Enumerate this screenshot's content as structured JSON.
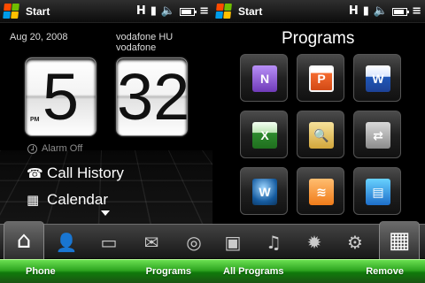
{
  "status_bar": {
    "start_label": "Start",
    "icons": [
      "h-connection-icon",
      "signal-icon",
      "volume-icon",
      "battery-icon",
      "menu-icon"
    ]
  },
  "home": {
    "date": "Aug 20, 2008",
    "carrier": "vodafone HU vodafone",
    "clock": {
      "hour": "5",
      "minute": "32",
      "ampm": "PM"
    },
    "alarm_label": "Alarm Off",
    "links": [
      {
        "label": "Call History",
        "icon": "phone-icon"
      },
      {
        "label": "Calendar",
        "icon": "calendar-icon"
      }
    ]
  },
  "programs": {
    "title": "Programs",
    "tiles": [
      {
        "name": "OneNote",
        "icon": "onenote-icon",
        "glyph": "N"
      },
      {
        "name": "PowerPoint",
        "icon": "powerpoint-icon",
        "glyph": "P"
      },
      {
        "name": "Word",
        "icon": "word-icon",
        "glyph": "W"
      },
      {
        "name": "Excel",
        "icon": "excel-icon",
        "glyph": "X"
      },
      {
        "name": "File Explorer",
        "icon": "folder-search-icon",
        "glyph": "🔍"
      },
      {
        "name": "ActiveSync",
        "icon": "device-sync-icon",
        "glyph": "⇄"
      },
      {
        "name": "WordWeb",
        "icon": "wordweb-icon",
        "glyph": "W"
      },
      {
        "name": "RSS Reader",
        "icon": "rss-icon",
        "glyph": "≋"
      },
      {
        "name": "FM Radio",
        "icon": "radio-icon",
        "glyph": "▤"
      }
    ]
  },
  "dock": {
    "items": [
      {
        "icon": "home-icon",
        "glyph": "⌂",
        "selected": true
      },
      {
        "icon": "person-icon",
        "glyph": "👤",
        "selected": false
      },
      {
        "icon": "message-icon",
        "glyph": "▭",
        "selected": false
      },
      {
        "icon": "mail-icon",
        "glyph": "✉",
        "selected": false
      },
      {
        "icon": "globe-icon",
        "glyph": "◎",
        "selected": false
      },
      {
        "icon": "camera-icon",
        "glyph": "▣",
        "selected": false
      },
      {
        "icon": "music-icon",
        "glyph": "♫",
        "selected": false
      },
      {
        "icon": "weather-icon",
        "glyph": "✹",
        "selected": false
      },
      {
        "icon": "settings-icon",
        "glyph": "⚙",
        "selected": false
      },
      {
        "icon": "grid-icon",
        "glyph": "▦",
        "selected": true
      }
    ]
  },
  "softkeys": {
    "left_phone": "Phone",
    "right_programs": "Programs",
    "left_all_programs": "All Programs",
    "right_remove": "Remove"
  },
  "colors": {
    "softkey_green": "#2ea520",
    "dock_dark": "#2a2a2a",
    "text_white": "#ffffff"
  }
}
